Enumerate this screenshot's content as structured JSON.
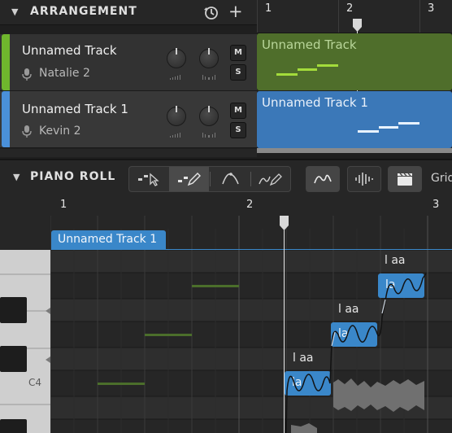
{
  "arrangement": {
    "title": "ARRANGEMENT",
    "ruler_numbers": [
      "1",
      "2",
      "3"
    ],
    "tracks": [
      {
        "name": "Unnamed Track",
        "singer": "Natalie 2",
        "color": "#6fb62d",
        "mute": "M",
        "solo": "S",
        "clip_label": "Unnamed Track",
        "clip_color": "#4f6e2b"
      },
      {
        "name": "Unnamed Track 1",
        "singer": "Kevin 2",
        "color": "#4a90d9",
        "mute": "M",
        "solo": "S",
        "clip_label": "Unnamed Track 1",
        "clip_color": "#3b78b8"
      }
    ]
  },
  "piano_roll": {
    "title": "PIANO ROLL",
    "grid_label": "Grid",
    "ruler_numbers": [
      "1",
      "2",
      "3"
    ],
    "clip_label": "Unnamed Track 1",
    "key_label": "C4",
    "notes": [
      {
        "lyric": "la",
        "phoneme": "l aa"
      },
      {
        "lyric": "la",
        "phoneme": "l aa"
      },
      {
        "lyric": "la",
        "phoneme": "l aa"
      }
    ]
  },
  "icons": [
    "chevron-down-icon",
    "history-icon",
    "add-icon",
    "mic-icon",
    "select-tool-icon",
    "pencil-tool-icon",
    "vibrato-tool-icon",
    "pitch-draw-tool-icon",
    "pitch-curve-icon",
    "waveform-icon",
    "clapperboard-icon"
  ],
  "colors": {
    "accent_blue": "#4a90d9",
    "accent_green": "#6fb62d",
    "note_blue": "#3a87c9"
  }
}
